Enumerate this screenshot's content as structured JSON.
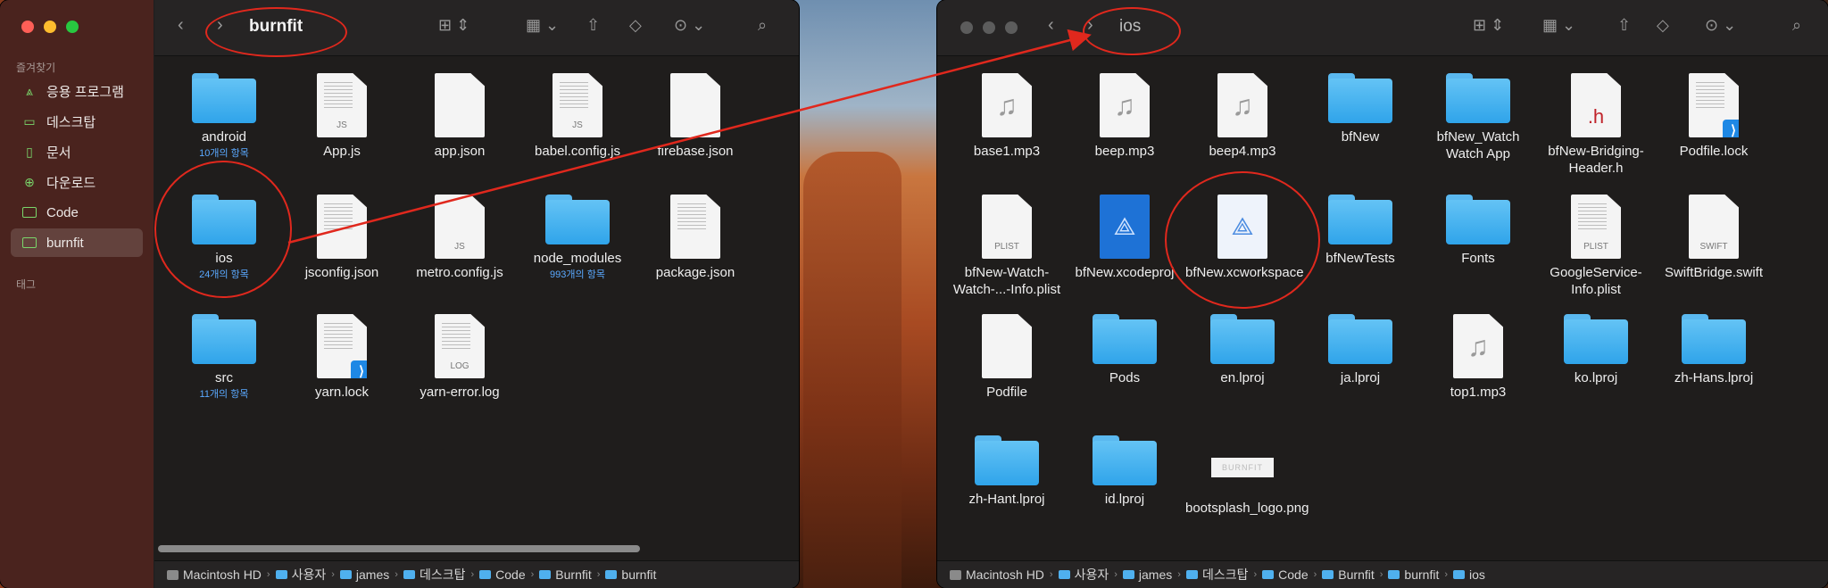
{
  "left_window": {
    "title": "burnfit",
    "sidebar": {
      "favorites_header": "즐겨찾기",
      "items": [
        {
          "label": "응용 프로그램",
          "icon": "apps-icon"
        },
        {
          "label": "데스크탑",
          "icon": "desktop-icon"
        },
        {
          "label": "문서",
          "icon": "document-icon"
        },
        {
          "label": "다운로드",
          "icon": "download-icon"
        },
        {
          "label": "Code",
          "icon": "folder-icon"
        },
        {
          "label": "burnfit",
          "icon": "folder-icon"
        }
      ],
      "tags_header": "태그"
    },
    "files": [
      {
        "name": "android",
        "kind": "folder",
        "sub": "10개의 항목"
      },
      {
        "name": "App.js",
        "kind": "doc",
        "tag": "JS"
      },
      {
        "name": "app.json",
        "kind": "doc",
        "tag": ""
      },
      {
        "name": "babel.config.js",
        "kind": "doc",
        "tag": "JS"
      },
      {
        "name": "firebase.json",
        "kind": "doc",
        "tag": ""
      },
      {
        "name": "ios",
        "kind": "folder",
        "sub": "24개의 항목"
      },
      {
        "name": "jsconfig.json",
        "kind": "doc",
        "tag": ""
      },
      {
        "name": "metro.config.js",
        "kind": "doc",
        "tag": "JS"
      },
      {
        "name": "node_modules",
        "kind": "folder",
        "sub": "993개의 항목"
      },
      {
        "name": "package.json",
        "kind": "doc",
        "tag": ""
      },
      {
        "name": "src",
        "kind": "folder",
        "sub": "11개의 항목"
      },
      {
        "name": "yarn.lock",
        "kind": "vscode",
        "tag": ""
      },
      {
        "name": "yarn-error.log",
        "kind": "doc",
        "tag": "LOG"
      }
    ],
    "path": [
      "Macintosh HD",
      "사용자",
      "james",
      "데스크탑",
      "Code",
      "Burnfit",
      "burnfit"
    ]
  },
  "right_window": {
    "title": "ios",
    "files": [
      {
        "name": "base1.mp3",
        "kind": "audio"
      },
      {
        "name": "beep.mp3",
        "kind": "audio"
      },
      {
        "name": "beep4.mp3",
        "kind": "audio"
      },
      {
        "name": "bfNew",
        "kind": "folder"
      },
      {
        "name": "bfNew_Watch Watch App",
        "kind": "folder"
      },
      {
        "name": "bfNew-Bridging-Header.h",
        "kind": "header"
      },
      {
        "name": "Podfile.lock",
        "kind": "vscode"
      },
      {
        "name": "bfNew-Watch-Watch-...-Info.plist",
        "kind": "doc",
        "tag": "PLIST"
      },
      {
        "name": "bfNew.xcodeproj",
        "kind": "xcproj"
      },
      {
        "name": "bfNew.xcworkspace",
        "kind": "xcws"
      },
      {
        "name": "bfNewTests",
        "kind": "folder"
      },
      {
        "name": "Fonts",
        "kind": "folder"
      },
      {
        "name": "GoogleService-Info.plist",
        "kind": "doc",
        "tag": "PLIST"
      },
      {
        "name": "SwiftBridge.swift",
        "kind": "doc",
        "tag": "SWIFT"
      },
      {
        "name": "Podfile",
        "kind": "doc",
        "tag": ""
      },
      {
        "name": "Pods",
        "kind": "folder"
      },
      {
        "name": "en.lproj",
        "kind": "folder"
      },
      {
        "name": "ja.lproj",
        "kind": "folder"
      },
      {
        "name": "top1.mp3",
        "kind": "audio"
      },
      {
        "name": "ko.lproj",
        "kind": "folder"
      },
      {
        "name": "zh-Hans.lproj",
        "kind": "folder"
      },
      {
        "name": "zh-Hant.lproj",
        "kind": "folder"
      },
      {
        "name": "id.lproj",
        "kind": "folder"
      },
      {
        "name": "bootsplash_logo.png",
        "kind": "png",
        "img_text": "BURNFIT"
      }
    ],
    "path": [
      "Macintosh HD",
      "사용자",
      "james",
      "데스크탑",
      "Code",
      "Burnfit",
      "burnfit",
      "ios"
    ]
  },
  "colors": {
    "annotation": "#e0281d",
    "folder": "#3fb0f0",
    "accent_sub": "#5aa9ff"
  }
}
